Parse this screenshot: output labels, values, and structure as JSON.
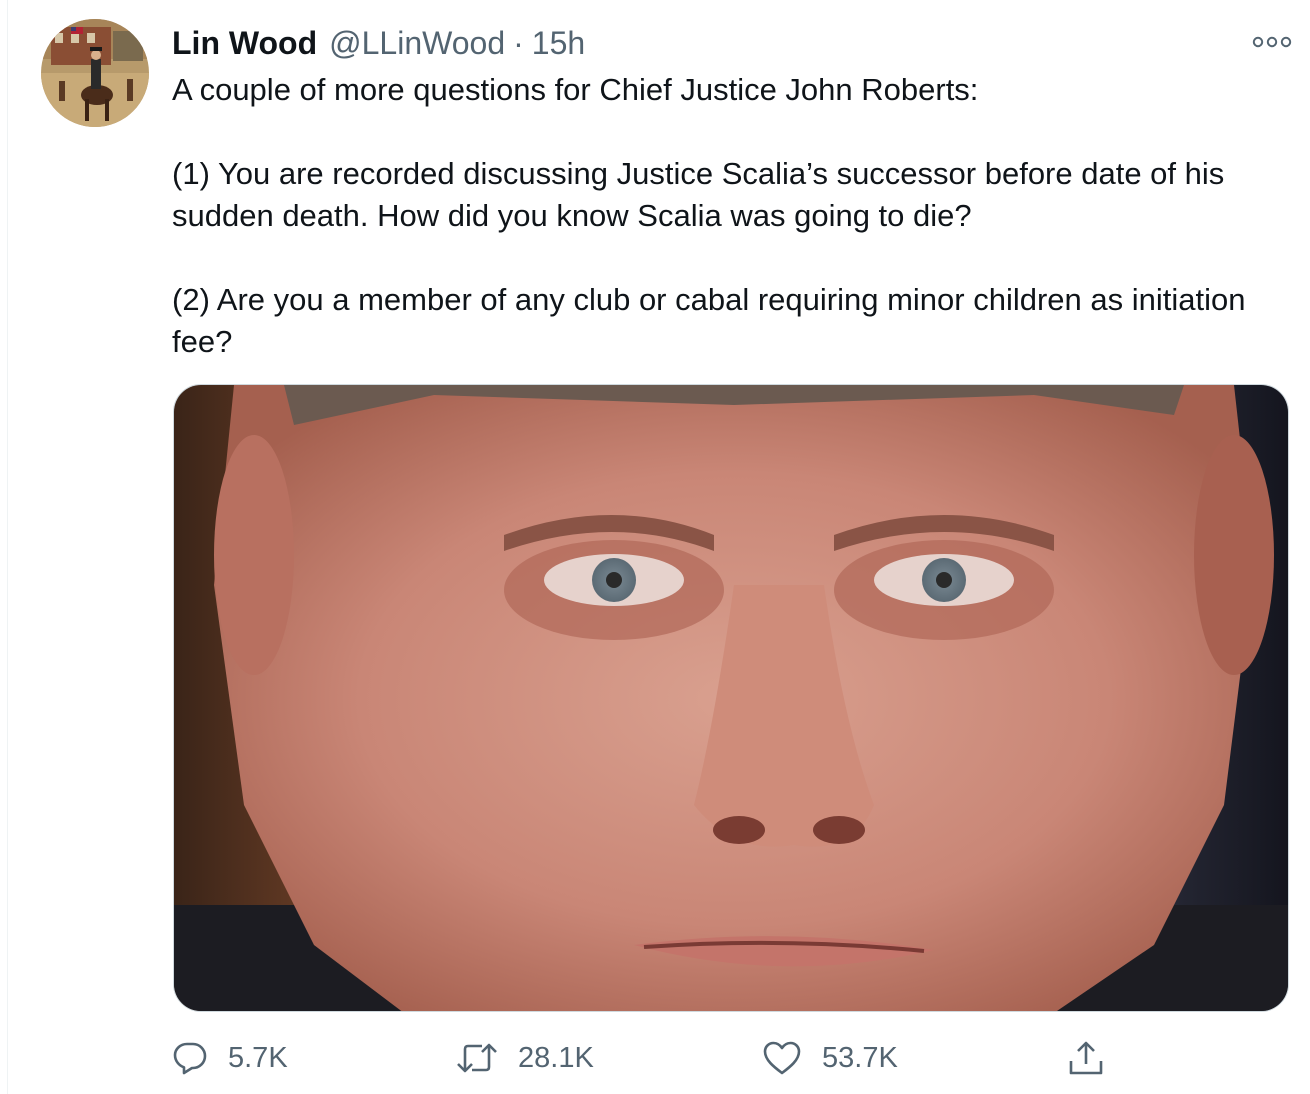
{
  "tweet": {
    "author_name": "Lin Wood",
    "author_handle": "@LLinWood",
    "separator": "·",
    "timestamp": "15h",
    "paragraphs": [
      "A couple of more questions for Chief Justice John Roberts:",
      "(1) You are recorded discussing Justice Scalia’s successor before date of his sudden death. How did you know Scalia was going to die?",
      "(2) Are you a member of any club or cabal requiring minor children as initiation fee?"
    ]
  },
  "actions": {
    "reply_count": "5.7K",
    "retweet_count": "28.1K",
    "like_count": "53.7K"
  },
  "icons": {
    "avatar": "avatar-painting-icon",
    "more": "more-dots-icon",
    "reply": "reply-icon",
    "retweet": "retweet-icon",
    "like": "heart-icon",
    "share": "share-icon"
  },
  "colors": {
    "text_primary": "#0f1419",
    "text_secondary": "#536471",
    "border": "#cfd9de"
  }
}
